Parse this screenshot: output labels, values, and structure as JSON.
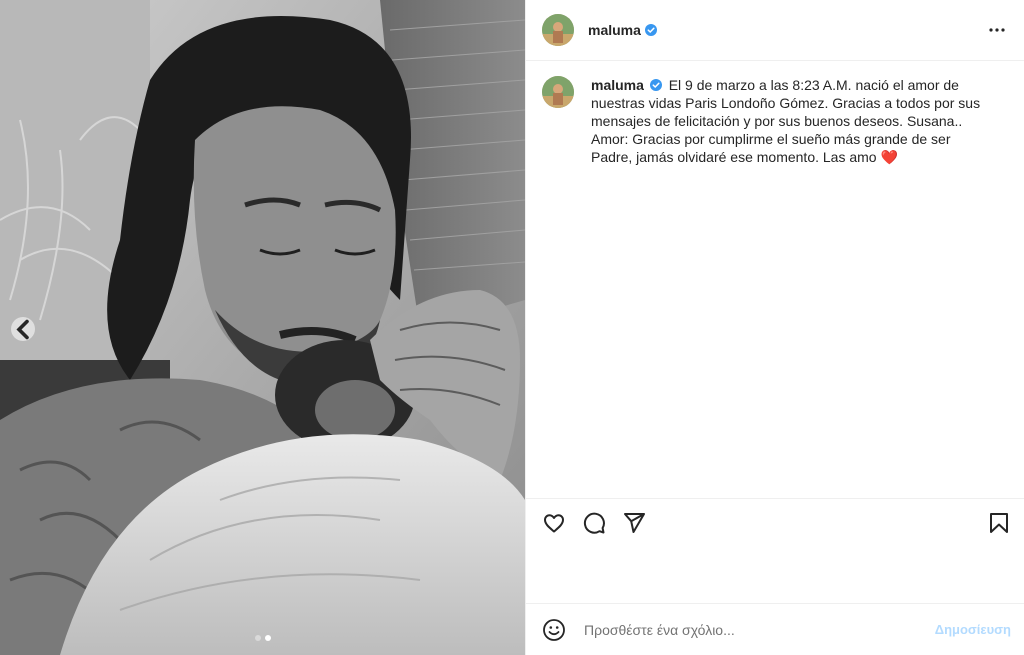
{
  "post": {
    "username": "maluma",
    "caption_body": "El 9 de marzo a las 8:23 A.M. nació el amor de nuestras vidas Paris Londoño Gómez. Gracias a todos por sus mensajes de felicitación y por sus buenos deseos. Susana.. Amor: Gracias por cumplirme el sueño más grande de ser Padre, jamás olvidaré ese momento. Las amo",
    "caption_emoji": "❤️"
  },
  "comment": {
    "placeholder": "Προσθέστε ένα σχόλιο...",
    "post_label": "Δημοσίευση"
  },
  "icons": {
    "verified": "verified-badge-icon",
    "more": "more-options-icon",
    "like": "heart-icon",
    "comment": "comment-icon",
    "share": "send-icon",
    "save": "bookmark-icon",
    "emoji": "emoji-icon",
    "prev": "chevron-left-icon"
  },
  "colors": {
    "verified": "#3897f0",
    "post_button_disabled": "#b3dbff",
    "heart_emoji": "#e0245e"
  },
  "carousel": {
    "slides": 2,
    "current": 1
  }
}
